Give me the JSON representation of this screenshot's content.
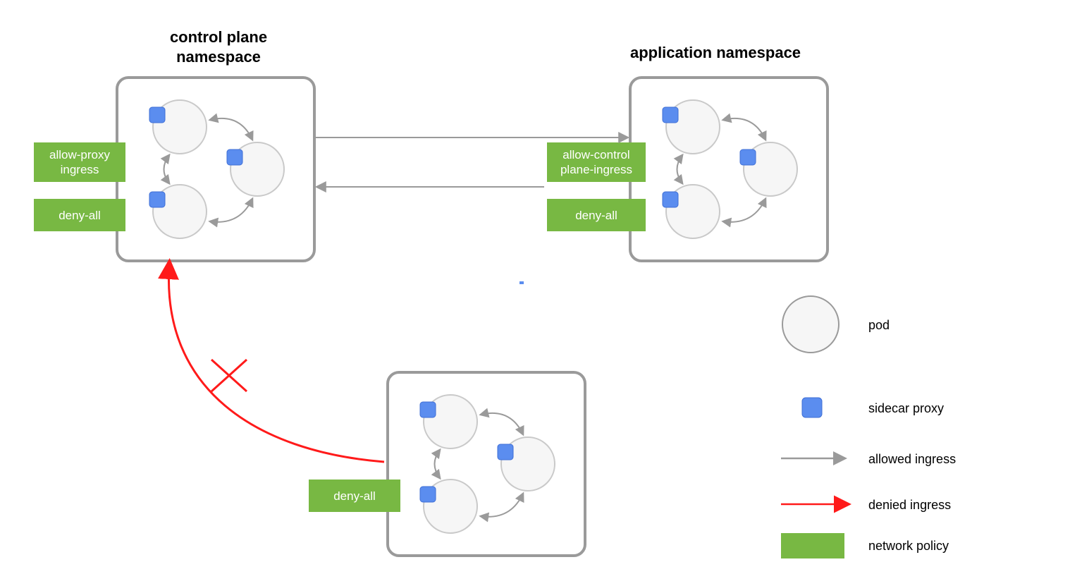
{
  "namespaces": {
    "control_plane": {
      "title_l1": "control plane",
      "title_l2": "namespace"
    },
    "application": {
      "title_l1": "application namespace"
    }
  },
  "policies": {
    "cp_allow_l1": "allow-proxy",
    "cp_allow_l2": "ingress",
    "cp_deny": "deny-all",
    "app_allow_l1": "allow-control",
    "app_allow_l2": "plane-ingress",
    "app_deny": "deny-all",
    "bottom_deny": "deny-all"
  },
  "legend": {
    "pod": "pod",
    "sidecar": "sidecar proxy",
    "allowed": "allowed ingress",
    "denied": "denied ingress",
    "policy": "network policy"
  },
  "colors": {
    "green": "#78b843",
    "blue": "#5b8def",
    "gray": "#9a9a9a",
    "lightbg": "#f6f6f6",
    "red": "#ff1a1a"
  }
}
